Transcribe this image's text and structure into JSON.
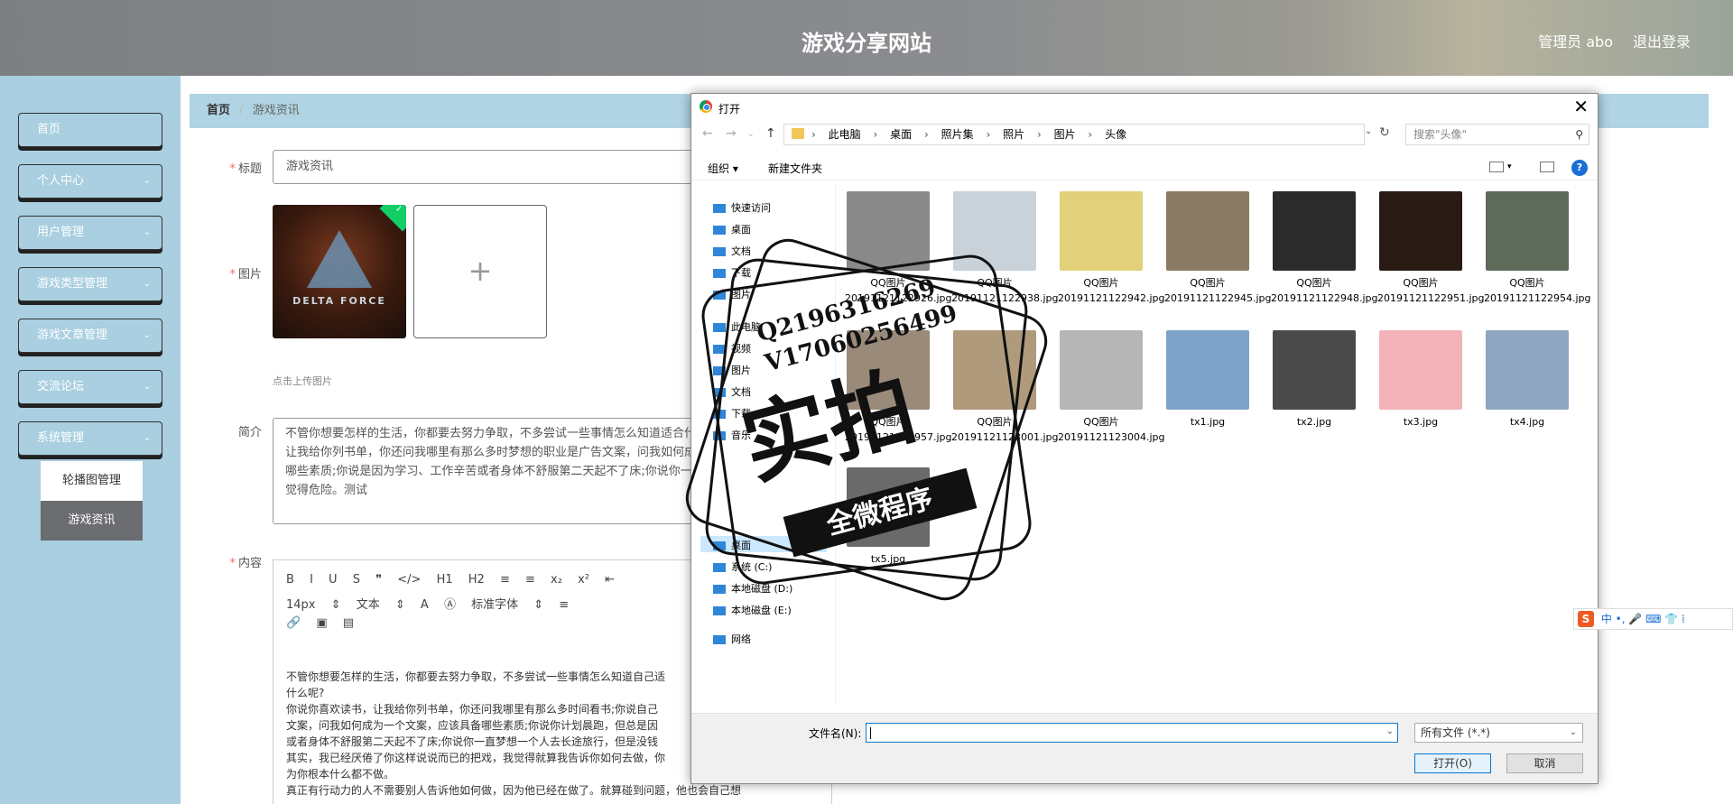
{
  "header": {
    "title": "游戏分享网站",
    "user_label": "管理员 abo",
    "logout_label": "退出登录"
  },
  "sidebar": {
    "items": [
      {
        "label": "首页"
      },
      {
        "label": "个人中心"
      },
      {
        "label": "用户管理"
      },
      {
        "label": "游戏类型管理"
      },
      {
        "label": "游戏文章管理"
      },
      {
        "label": "交流论坛"
      },
      {
        "label": "系统管理"
      }
    ],
    "subitems": [
      {
        "label": "轮播图管理"
      },
      {
        "label": "游戏资讯"
      }
    ]
  },
  "breadcrumb": {
    "home": "首页",
    "separator": "/",
    "current": "游戏资讯"
  },
  "form": {
    "title_label": "标题",
    "title_value": "游戏资讯",
    "image_label": "图片",
    "image_text": "DELTA FORCE",
    "upload_plus": "+",
    "upload_hint": "点击上传图片",
    "intro_label": "简介",
    "intro_value": "不管你想要怎样的生活，你都要去努力争取，不多尝试一些事情怎么知道适合什么呢?你说你喜欢读书，让我给你列书单，你还问我哪里有那么多时梦想的职业是广告文案，问我如何成为一个文案，应该具备哪些素质;你说是因为学习、工作辛苦或者身体不舒服第二天起不了床;你说你一直梦想但是没钱，父母觉得危险。测试",
    "content_label": "内容",
    "required_mark": "*"
  },
  "editor": {
    "toolbar_row1": [
      "B",
      "I",
      "U",
      "S",
      "❞",
      "</>",
      "H1",
      "H2",
      "≡",
      "≡",
      "x₂",
      "x²",
      "⇤"
    ],
    "font_size": "14px",
    "font_type": "文本",
    "font_family": "标准字体",
    "body_lines": [
      "不管你想要怎样的生活，你都要去努力争取，不多尝试一些事情怎么知道自己适",
      "什么呢?",
      "你说你喜欢读书，让我给你列书单，你还问我哪里有那么多时间看书;你说自己",
      "文案，问我如何成为一个文案，应该具备哪些素质;你说你计划晨跑，但总是因",
      "或者身体不舒服第二天起不了床;你说你一直梦想一个人去长途旅行，但是没钱",
      "其实，我已经厌倦了你这样说说而已的把戏，我觉得就算我告诉你如何去做，你",
      "为你根本什么都不做。",
      "真正有行动力的人不需要别人告诉他如何做，因为他已经在做了。就算碰到问题，他也会自己想"
    ]
  },
  "dialog": {
    "title": "打开",
    "close": "✕",
    "path": [
      "此电脑",
      "桌面",
      "照片集",
      "照片",
      "图片",
      "头像"
    ],
    "search_placeholder": "搜索\"头像\"",
    "organize": "组织 ▾",
    "new_folder": "新建文件夹",
    "help": "?",
    "nav_pane": [
      "快速访问",
      "桌面",
      "文档",
      "下载",
      "图片",
      "此电脑",
      "视频",
      "图片",
      "文档",
      "下载",
      "音乐",
      "桌面",
      "系统 (C:)",
      "本地磁盘 (D:)",
      "本地磁盘 (E:)",
      "网络"
    ],
    "files": [
      {
        "name": "QQ图片 20191121122926.jpg",
        "color": "#8a8a8a"
      },
      {
        "name": "QQ图片 20191121122938.jpg",
        "color": "#c9d2d8"
      },
      {
        "name": "QQ图片 20191121122942.jpg",
        "color": "#e3d07a"
      },
      {
        "name": "QQ图片 20191121122945.jpg",
        "color": "#8b7a63"
      },
      {
        "name": "QQ图片 20191121122948.jpg",
        "color": "#2b2b2b"
      },
      {
        "name": "QQ图片 20191121122951.jpg",
        "color": "#2a1a14"
      },
      {
        "name": "QQ图片 20191121122954.jpg",
        "color": "#5e6b5a"
      },
      {
        "name": "QQ图片 20191121122957.jpg",
        "color": "#9a8a7a"
      },
      {
        "name": "QQ图片 20191121123001.jpg",
        "color": "#b09a7c"
      },
      {
        "name": "QQ图片 20191121123004.jpg",
        "color": "#b6b6b6"
      },
      {
        "name": "tx1.jpg",
        "color": "#7ea2c9"
      },
      {
        "name": "tx2.jpg",
        "color": "#4a4a4a"
      },
      {
        "name": "tx3.jpg",
        "color": "#f3b3b8"
      },
      {
        "name": "tx4.jpg",
        "color": "#8fa5c0"
      },
      {
        "name": "tx5.jpg",
        "color": "#6a6a6a"
      }
    ],
    "filename_label": "文件名(N):",
    "filetype": "所有文件 (*.*)",
    "open_label": "打开(O)",
    "cancel_label": "取消"
  },
  "stamp": {
    "line1": "Q2196316269",
    "line2": "V17060256499",
    "main": "实拍",
    "ribbon": "全微程序"
  },
  "ime": {
    "logo": "S",
    "text": "中 •, 🎤 ⌨ 👕 ⁞"
  }
}
